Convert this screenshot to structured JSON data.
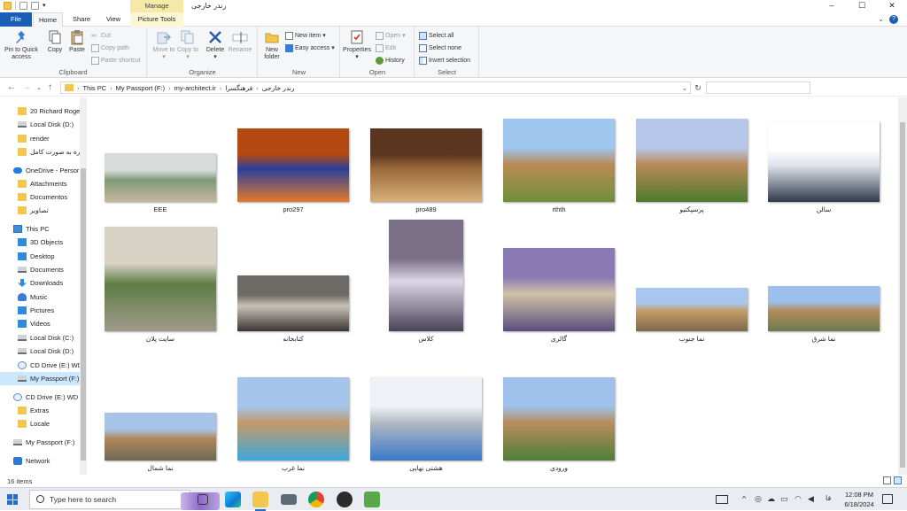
{
  "window": {
    "title": "رندر خارجی",
    "manage_tab": "Manage",
    "controls": {
      "minimize": "–",
      "maximize": "☐",
      "close": "✕"
    }
  },
  "tabs": {
    "file": "File",
    "home": "Home",
    "share": "Share",
    "view": "View",
    "picture_tools": "Picture Tools"
  },
  "ribbon": {
    "clipboard": {
      "label": "Clipboard",
      "pin": "Pin to Quick access",
      "copy": "Copy",
      "paste": "Paste",
      "cut": "Cut",
      "copy_path": "Copy path",
      "paste_shortcut": "Paste shortcut"
    },
    "organize": {
      "label": "Organize",
      "move_to": "Move to",
      "copy_to": "Copy to",
      "delete": "Delete",
      "rename": "Rename"
    },
    "new": {
      "label": "New",
      "new_folder": "New folder",
      "new_item": "New item",
      "easy_access": "Easy access"
    },
    "open": {
      "label": "Open",
      "properties": "Properties",
      "open": "Open",
      "edit": "Edit",
      "history": "History"
    },
    "select": {
      "label": "Select",
      "select_all": "Select all",
      "select_none": "Select none",
      "invert": "Invert selection"
    }
  },
  "address": {
    "crumbs": [
      "This PC",
      "My Passport (F:)",
      "my-architect.ir",
      "فرهنگسرا",
      "رندر خارجی"
    ],
    "search_placeholder": ""
  },
  "nav": [
    {
      "label": "20 Richard Roge",
      "icon": "folder-icon",
      "kind": "folder"
    },
    {
      "label": "Local Disk (D:)",
      "icon": "drive-icon",
      "kind": "drive"
    },
    {
      "label": "render",
      "icon": "folder-icon",
      "kind": "folder"
    },
    {
      "label": "ره به صورت کامل",
      "icon": "folder-icon",
      "kind": "folder"
    },
    {
      "label": "OneDrive - Persor",
      "icon": "cloud-icon",
      "kind": "cloud"
    },
    {
      "label": "Attachments",
      "icon": "folder-icon",
      "kind": "folder"
    },
    {
      "label": "Documentos",
      "icon": "folder-icon",
      "kind": "folder"
    },
    {
      "label": "تصاویر",
      "icon": "folder-icon",
      "kind": "folder"
    },
    {
      "label": "This PC",
      "icon": "computer-icon",
      "kind": "pc"
    },
    {
      "label": "3D Objects",
      "icon": "cube-icon",
      "kind": "blue"
    },
    {
      "label": "Desktop",
      "icon": "desktop-icon",
      "kind": "blue"
    },
    {
      "label": "Documents",
      "icon": "documents-icon",
      "kind": "drive"
    },
    {
      "label": "Downloads",
      "icon": "download-icon",
      "kind": "down"
    },
    {
      "label": "Music",
      "icon": "music-icon",
      "kind": "music"
    },
    {
      "label": "Pictures",
      "icon": "pictures-icon",
      "kind": "blue"
    },
    {
      "label": "Videos",
      "icon": "videos-icon",
      "kind": "blue"
    },
    {
      "label": "Local Disk (C:)",
      "icon": "drive-icon",
      "kind": "drive"
    },
    {
      "label": "Local Disk (D:)",
      "icon": "drive-icon",
      "kind": "drive"
    },
    {
      "label": "CD Drive (E:) WD",
      "icon": "cd-icon",
      "kind": "cd"
    },
    {
      "label": "My Passport (F:)",
      "icon": "drive-icon",
      "kind": "drive",
      "selected": true
    },
    {
      "label": "CD Drive (E:) WD U",
      "icon": "cd-icon",
      "kind": "cd"
    },
    {
      "label": "Extras",
      "icon": "folder-icon",
      "kind": "folder"
    },
    {
      "label": "Locale",
      "icon": "folder-icon",
      "kind": "folder"
    },
    {
      "label": "My Passport (F:)",
      "icon": "drive-icon",
      "kind": "drive"
    },
    {
      "label": "Network",
      "icon": "network-icon",
      "kind": "net"
    }
  ],
  "files": [
    {
      "name": "EEE",
      "colors": [
        "#d7dbd9",
        "#7f9a78",
        "#c5b79e"
      ]
    },
    {
      "name": "pro297",
      "colors": [
        "#b44a12",
        "#2a3f9a",
        "#e37a2a"
      ]
    },
    {
      "name": "pro489",
      "colors": [
        "#5a3520",
        "#9b6a3a",
        "#d7b07a"
      ]
    },
    {
      "name": "rthth",
      "colors": [
        "#9fc6ef",
        "#b88c55",
        "#6f8f3a"
      ]
    },
    {
      "name": "پرسپکتیو",
      "colors": [
        "#b7c7ea",
        "#b98a5a",
        "#4d7a2e"
      ]
    },
    {
      "name": "سالن",
      "colors": [
        "#ffffff",
        "#dde3ea",
        "#2f3a4a"
      ]
    },
    {
      "name": "سایت پلان",
      "colors": [
        "#d9d3c6",
        "#5e7d43",
        "#a09a8c"
      ]
    },
    {
      "name": "کتابخانه",
      "colors": [
        "#6e6a66",
        "#c9c2b8",
        "#3a3632"
      ]
    },
    {
      "name": "کلاس",
      "colors": [
        "#7a6f86",
        "#dcd8e6",
        "#4a4358"
      ]
    },
    {
      "name": "گالری",
      "colors": [
        "#8a79b4",
        "#cfc3a6",
        "#5a4c7e"
      ]
    },
    {
      "name": "نما جنوب",
      "colors": [
        "#a9c7ee",
        "#c49a62",
        "#7b6a4d"
      ]
    },
    {
      "name": "نما شرق",
      "colors": [
        "#9cc0ea",
        "#b48b5b",
        "#6b7a4d"
      ]
    },
    {
      "name": "نما شمال",
      "colors": [
        "#a7c3e8",
        "#b08658",
        "#6d6a55"
      ]
    },
    {
      "name": "نما غرب",
      "colors": [
        "#a4c4ec",
        "#c2996a",
        "#3fa7d9"
      ]
    },
    {
      "name": "هشتی نهایی",
      "colors": [
        "#eef2f6",
        "#b0b8c2",
        "#3a78c9"
      ]
    },
    {
      "name": "ورودی",
      "colors": [
        "#9ec0ea",
        "#b88c5a",
        "#4f7f3a"
      ]
    }
  ],
  "status": {
    "count": "16 items"
  },
  "taskbar": {
    "search_placeholder": "Type here to search",
    "lang": "فا",
    "time": "12:08 PM",
    "date": "6/18/2024"
  }
}
